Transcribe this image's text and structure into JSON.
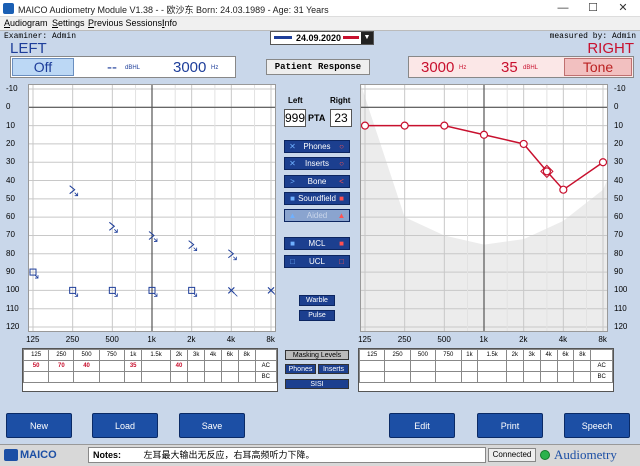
{
  "window": {
    "title": "MAICO Audiometry Module V1.38 - - 欧沙东   Born: 24.03.1989 - Age: 31 Years",
    "min": "—",
    "max": "☐",
    "close": "✕"
  },
  "menu": [
    "Audiogram",
    "Settings",
    "Previous Sessions!",
    "Info"
  ],
  "header": {
    "examiner": "Examiner:  Admin",
    "measured_by": "measured by: Admin",
    "left_title": "LEFT",
    "right_title": "RIGHT",
    "date": "24.09.2020",
    "dropdown_icon": "▼"
  },
  "left_panel": {
    "off_label": "Off",
    "level": "--",
    "level_unit": "dBHL",
    "freq": "3000",
    "freq_unit": "Hz"
  },
  "right_panel": {
    "freq": "3000",
    "freq_unit": "Hz",
    "level": "35",
    "level_unit": "dBHL",
    "tone_label": "Tone"
  },
  "patient_response": "Patient Response",
  "pta": {
    "left_label": "Left",
    "right_label": "Right",
    "left_value": "999",
    "pta_label": "PTA",
    "right_value": "23"
  },
  "transducers": [
    {
      "label": "Phones",
      "left_icon": "✕",
      "right_icon": "○",
      "enabled": true
    },
    {
      "label": "Inserts",
      "left_icon": "✕",
      "right_icon": "○",
      "enabled": true
    },
    {
      "label": "Bone",
      "left_icon": ">",
      "right_icon": "<",
      "enabled": true
    },
    {
      "label": "Soundfield",
      "left_icon": "■",
      "right_icon": "■",
      "enabled": true
    },
    {
      "label": "Aided",
      "left_icon": "▲",
      "right_icon": "▲",
      "enabled": false
    }
  ],
  "masking": [
    {
      "label": "MCL",
      "left_icon": "■",
      "right_icon": "■"
    },
    {
      "label": "UCL",
      "left_icon": "□",
      "right_icon": "□"
    }
  ],
  "signal_buttons": [
    "Warble",
    "Pulse"
  ],
  "table_buttons": [
    "Masking Levels",
    "Phones",
    "Inserts",
    "SISI"
  ],
  "axes": {
    "db_ticks": [
      "-10",
      "0",
      "10",
      "20",
      "30",
      "40",
      "50",
      "60",
      "70",
      "80",
      "90",
      "100",
      "110",
      "120"
    ],
    "freq_ticks": [
      "125",
      "250",
      "500",
      "1k",
      "2k",
      "4k",
      "8k"
    ]
  },
  "chart_data": [
    {
      "type": "scatter",
      "ear": "left",
      "x_scale": "log",
      "ylim": [
        -10,
        120
      ],
      "y_inverted": true,
      "bone": [
        {
          "x": 250,
          "y": 45
        },
        {
          "x": 500,
          "y": 65
        },
        {
          "x": 1000,
          "y": 70
        },
        {
          "x": 2000,
          "y": 75
        },
        {
          "x": 4000,
          "y": 80
        }
      ],
      "ucl": [
        {
          "x": 125,
          "y": 90
        },
        {
          "x": 250,
          "y": 100
        },
        {
          "x": 500,
          "y": 100
        },
        {
          "x": 1000,
          "y": 100
        },
        {
          "x": 2000,
          "y": 100
        }
      ],
      "air_nr": [
        {
          "x": 4000,
          "y": 100
        },
        {
          "x": 8000,
          "y": 100
        }
      ]
    },
    {
      "type": "line",
      "ear": "right",
      "x_scale": "log",
      "ylim": [
        -10,
        120
      ],
      "y_inverted": true,
      "air": [
        {
          "x": 125,
          "y": 10
        },
        {
          "x": 250,
          "y": 10
        },
        {
          "x": 500,
          "y": 10
        },
        {
          "x": 1000,
          "y": 15
        },
        {
          "x": 2000,
          "y": 20
        },
        {
          "x": 3000,
          "y": 35
        },
        {
          "x": 4000,
          "y": 45
        },
        {
          "x": 8000,
          "y": 30
        }
      ],
      "current": {
        "x": 3000,
        "y": 35
      }
    }
  ],
  "thresholds": {
    "columns": [
      "125",
      "250",
      "500",
      "750",
      "1k",
      "1.5k",
      "2k",
      "3k",
      "4k",
      "6k",
      "8k"
    ],
    "left_ac": [
      "50",
      "70",
      "40",
      "",
      "35",
      "",
      "40",
      "",
      "",
      "",
      ""
    ],
    "right_ac": [
      "",
      "",
      "",
      "",
      "",
      "",
      "",
      "",
      "",
      "",
      ""
    ],
    "row_labels": [
      "AC",
      "BC"
    ]
  },
  "bottom_buttons": [
    "New",
    "Load",
    "Save",
    "Edit",
    "Print",
    "Speech"
  ],
  "status": {
    "brand": "MAICO",
    "notes_label": "Notes:",
    "notes": "左耳最大输出无反应，右耳高频听力下降。",
    "connection": "Connected",
    "module": "Audiometry"
  },
  "colors": {
    "left": "#1e3e9a",
    "right": "#c8102e"
  }
}
